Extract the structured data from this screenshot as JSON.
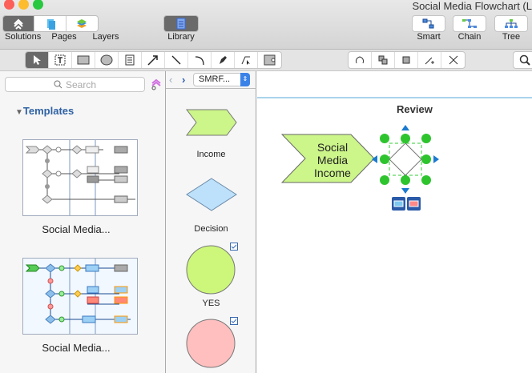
{
  "window": {
    "title": "Social Media Flowchart (L"
  },
  "top_toolbar": {
    "solutions": "Solutions",
    "pages": "Pages",
    "layers": "Layers",
    "library": "Library",
    "smart": "Smart",
    "chain": "Chain",
    "tree": "Tree"
  },
  "left_panel": {
    "search_placeholder": "Search",
    "section": "Templates",
    "templates": [
      {
        "label": "Social Media..."
      },
      {
        "label": "Social Media..."
      }
    ]
  },
  "library": {
    "selected": "SMRF...",
    "shapes": [
      {
        "label": "Income"
      },
      {
        "label": "Decision"
      },
      {
        "label": "YES"
      },
      {
        "label": ""
      }
    ]
  },
  "canvas": {
    "title": "Review",
    "shape_text": [
      "Social",
      "Media",
      "Income"
    ]
  },
  "colors": {
    "accent": "#2f62a4",
    "income": "#ccf58a",
    "decision": "#bde0fb",
    "yes": "#ccf77a",
    "no": "#ffbfbf",
    "handle": "#2ec42e"
  }
}
